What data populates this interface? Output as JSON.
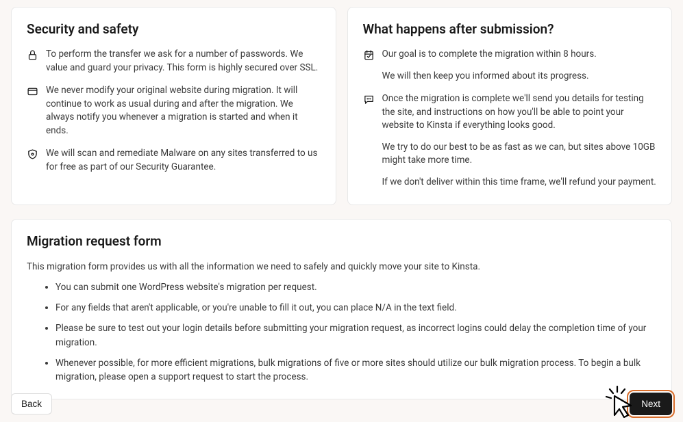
{
  "security_card": {
    "title": "Security and safety",
    "items": [
      {
        "icon": "lock-icon",
        "text": "To perform the transfer we ask for a number of passwords. We value and guard your privacy. This form is highly secured over SSL."
      },
      {
        "icon": "card-icon",
        "text": "We never modify your original website during migration. It will continue to work as usual during and after the migration. We always notify you whenever a migration is started and when it ends."
      },
      {
        "icon": "shield-icon",
        "text": "We will scan and remediate Malware on any sites transferred to us for free as part of our Security Guarantee."
      }
    ]
  },
  "after_card": {
    "title": "What happens after submission?",
    "block1": {
      "icon": "calendar-icon",
      "p1": "Our goal is to complete the migration within 8 hours.",
      "p2": "We will then keep you informed about its progress."
    },
    "block2": {
      "icon": "chat-icon",
      "p1": "Once the migration is complete we'll send you details for testing the site, and instructions on how you'll be able to point your website to Kinsta if everything looks good.",
      "p2": "We try to do our best to be as fast as we can, but sites above 10GB might take more time.",
      "p3": "If we don't deliver within this time frame, we'll refund your payment."
    }
  },
  "form_card": {
    "title": "Migration request form",
    "intro": "This migration form provides us with all the information we need to safely and quickly move your site to Kinsta.",
    "bullets": [
      "You can submit one WordPress website's migration per request.",
      "For any fields that aren't applicable, or you're unable to fill it out, you can place N/A in the text field.",
      "Please be sure to test out your login details before submitting your migration request, as incorrect logins could delay the completion time of your migration.",
      "Whenever possible, for more efficient migrations, bulk migrations of five or more sites should utilize our bulk migration process. To begin a bulk migration, please open a support request to start the process."
    ]
  },
  "footer": {
    "back_label": "Back",
    "next_label": "Next"
  }
}
